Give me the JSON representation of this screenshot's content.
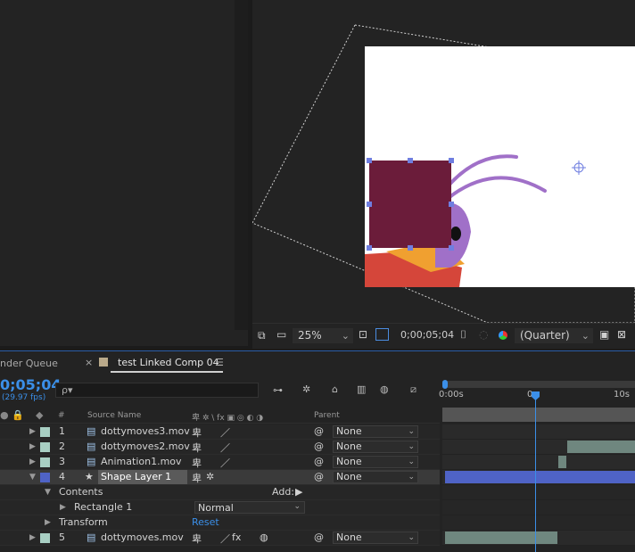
{
  "tabs": {
    "render_queue": "nder Queue",
    "comp_close": "×",
    "comp_tab": "test Linked Comp 04",
    "comp_menu": "☰"
  },
  "viewer": {
    "zoom": "25%",
    "timecode": "0;00;05;04",
    "resolution": "(Quarter)",
    "shape_color": "#6b1c3a"
  },
  "timeline": {
    "current_time": "0;05;04",
    "fps": "(29.97 fps)",
    "search_placeholder": "ρ▾",
    "ruler_labels": [
      "0:00s",
      "0",
      "10s"
    ],
    "headers": {
      "hash": "#",
      "source_name": "Source Name",
      "parent": "Parent",
      "switch_labels": "卑 ✲ \\ fx ▣ ◎ ◐ ◑"
    },
    "layers": [
      {
        "num": "1",
        "name": "dottymoves3.mov",
        "parent": "None",
        "color": "#a8cfc3"
      },
      {
        "num": "2",
        "name": "dottymoves2.mov",
        "parent": "None",
        "color": "#a8cfc3"
      },
      {
        "num": "3",
        "name": "Animation1.mov",
        "parent": "None",
        "color": "#a8cfc3"
      },
      {
        "num": "4",
        "name": "Shape Layer 1",
        "parent": "None",
        "color": "#4f63c6"
      },
      {
        "num": "5",
        "name": "dottymoves.mov",
        "parent": "None",
        "color": "#a8cfc3"
      }
    ],
    "contents_label": "Contents",
    "add_label": "Add:",
    "rectangle_label": "Rectangle 1",
    "blend_mode": "Normal",
    "transform_label": "Transform",
    "reset_label": "Reset",
    "none_label": "None"
  }
}
